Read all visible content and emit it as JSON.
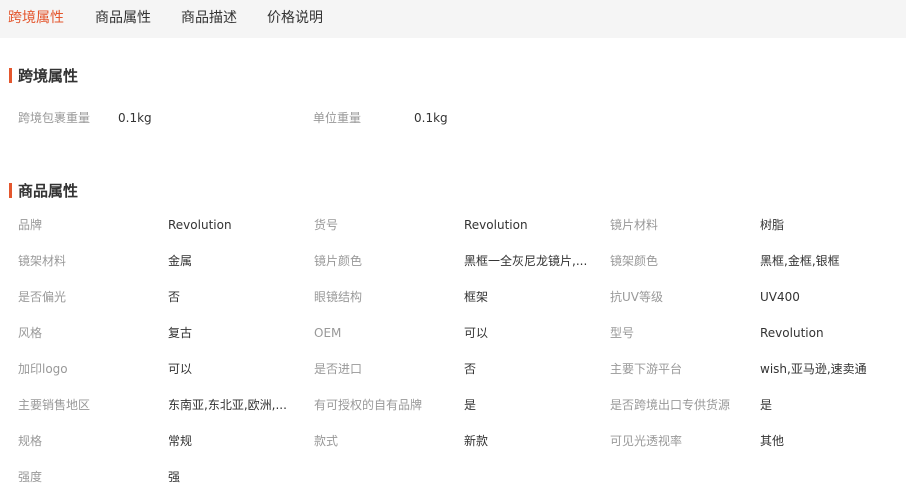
{
  "tabs": [
    {
      "label": "跨境属性",
      "active": true
    },
    {
      "label": "商品属性",
      "active": false
    },
    {
      "label": "商品描述",
      "active": false
    },
    {
      "label": "价格说明",
      "active": false
    }
  ],
  "crossborder": {
    "title": "跨境属性",
    "items": [
      {
        "label": "跨境包裹重量",
        "value": "0.1kg"
      },
      {
        "label": "单位重量",
        "value": "0.1kg"
      }
    ]
  },
  "product": {
    "title": "商品属性",
    "rows": [
      [
        {
          "label": "品牌",
          "value": "Revolution"
        },
        {
          "label": "货号",
          "value": "Revolution"
        },
        {
          "label": "镜片材料",
          "value": "树脂"
        }
      ],
      [
        {
          "label": "镜架材料",
          "value": "金属"
        },
        {
          "label": "镜片颜色",
          "value": "黑框一全灰尼龙镜片,..."
        },
        {
          "label": "镜架颜色",
          "value": "黑框,金框,银框"
        }
      ],
      [
        {
          "label": "是否偏光",
          "value": "否"
        },
        {
          "label": "眼镜结构",
          "value": "框架"
        },
        {
          "label": "抗UV等级",
          "value": "UV400"
        }
      ],
      [
        {
          "label": "风格",
          "value": "复古"
        },
        {
          "label": "OEM",
          "value": "可以"
        },
        {
          "label": "型号",
          "value": "Revolution"
        }
      ],
      [
        {
          "label": "加印logo",
          "value": "可以"
        },
        {
          "label": "是否进口",
          "value": "否"
        },
        {
          "label": "主要下游平台",
          "value": "wish,亚马逊,速卖通"
        }
      ],
      [
        {
          "label": "主要销售地区",
          "value": "东南亚,东北亚,欧洲,..."
        },
        {
          "label": "有可授权的自有品牌",
          "value": "是"
        },
        {
          "label": "是否跨境出口专供货源",
          "value": "是"
        }
      ],
      [
        {
          "label": "规格",
          "value": "常规"
        },
        {
          "label": "款式",
          "value": "新款"
        },
        {
          "label": "可见光透视率",
          "value": "其他"
        }
      ],
      [
        {
          "label": "强度",
          "value": "强"
        }
      ]
    ]
  }
}
